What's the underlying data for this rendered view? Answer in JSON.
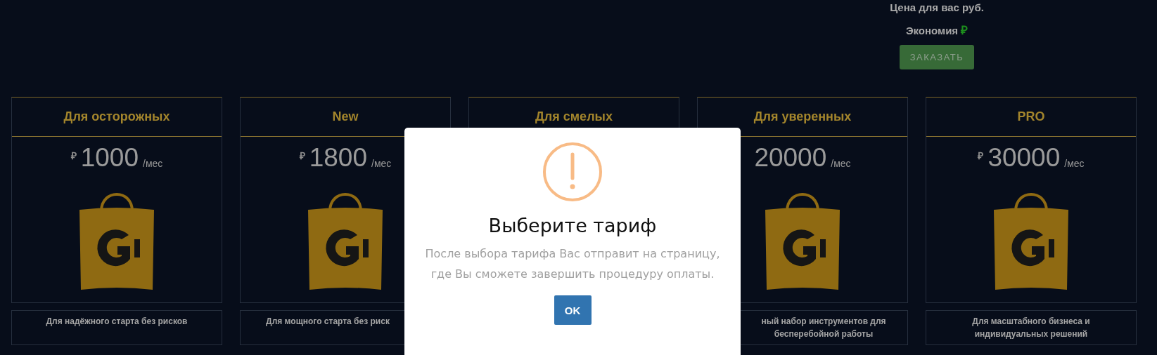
{
  "header": {
    "price_label": "Цена для вас руб.",
    "savings_label": "Экономия",
    "savings_currency": "₽",
    "order_button": "ЗАКАЗАТЬ"
  },
  "plans": [
    {
      "title": "Для осторожных",
      "currency": "₽",
      "price": "1000",
      "period": "/мес",
      "description": "Для надёжного старта без рисков"
    },
    {
      "title": "New",
      "currency": "₽",
      "price": "1800",
      "period": "/мес",
      "description": "Для мощного старта без риск"
    },
    {
      "title": "Для смелых"
    },
    {
      "title": "Для уверенных",
      "price": "20000",
      "period": "/мес",
      "description": "ный набор инструментов для бесперебойной работы"
    },
    {
      "title": "PRO",
      "currency": "₽",
      "price": "30000",
      "period": "/мес",
      "description": "Для масштабного бизнеса и индивидуальных решений"
    }
  ],
  "dialog": {
    "title": "Выберите тариф",
    "message": "После выбора тарифа Вас отправит на страницу, где Вы сможете завершить процедуру оплаты.",
    "ok_button": "OK"
  }
}
